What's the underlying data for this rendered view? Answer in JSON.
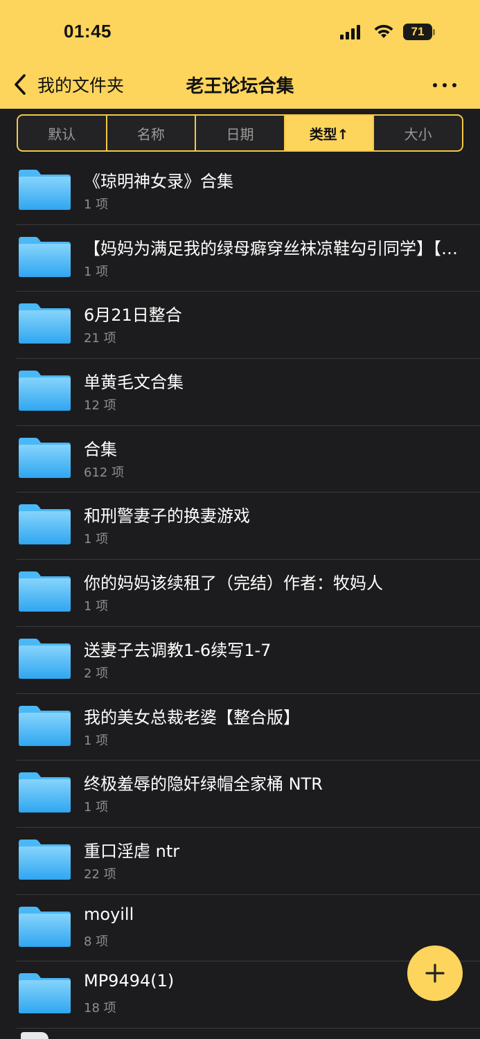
{
  "status": {
    "time": "01:45",
    "battery": "71",
    "battery_level_percent": 71
  },
  "nav": {
    "back_label": "我的文件夹",
    "title": "老王论坛合集"
  },
  "sort_tabs": [
    {
      "label": "默认"
    },
    {
      "label": "名称"
    },
    {
      "label": "日期"
    },
    {
      "label": "类型↑"
    },
    {
      "label": "大小"
    }
  ],
  "sort_active_index": 3,
  "folders": [
    {
      "name": "《琼明神女录》合集",
      "count": "1 项"
    },
    {
      "name": "【妈妈为满足我的绿母癖穿丝袜凉鞋勾引同学】【…",
      "count": "1 项"
    },
    {
      "name": "6月21日整合",
      "count": "21 项"
    },
    {
      "name": "单黄毛文合集",
      "count": "12 项"
    },
    {
      "name": "合集",
      "count": "612 项"
    },
    {
      "name": "和刑警妻子的换妻游戏",
      "count": "1 项"
    },
    {
      "name": "你的妈妈该续租了（完结）作者：牧妈人",
      "count": "1 项"
    },
    {
      "name": "送妻子去调教1-6续写1-7",
      "count": "2 项"
    },
    {
      "name": "我的美女总裁老婆【整合版】",
      "count": "1 项"
    },
    {
      "name": "终极羞辱的隐奸绿帽全家桶 NTR",
      "count": "1 项"
    },
    {
      "name": "重口淫虐 ntr",
      "count": "22 项"
    },
    {
      "name": "moyill",
      "count": "8 项"
    },
    {
      "name": "MP9494(1)",
      "count": "18 项"
    }
  ],
  "colors": {
    "accent": "#fdd45c",
    "background": "#1c1c1e",
    "folder_top": "#7fd0fb",
    "folder_bottom": "#33aaf2"
  },
  "icons": {
    "back": "chevron-left-icon",
    "more": "ellipsis-icon",
    "folder": "folder-icon",
    "fab": "plus-icon"
  }
}
